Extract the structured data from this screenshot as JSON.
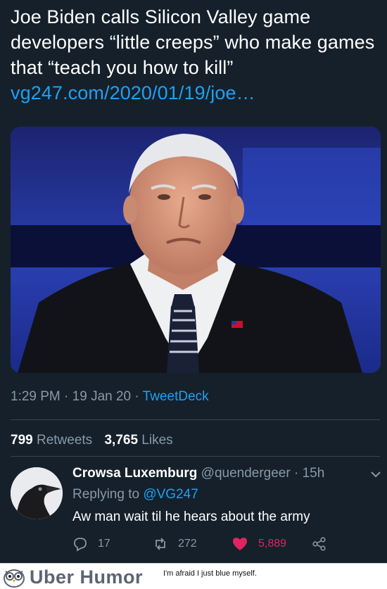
{
  "tweet": {
    "text": "Joe Biden calls Silicon Valley game developers “little creeps” who make games that “teach you how to kill”",
    "link": "vg247.com/2020/01/19/joe…",
    "time": "1:29 PM",
    "date": "19 Jan 20",
    "app": "TweetDeck",
    "retweets_count": "799",
    "retweets_label": "Retweets",
    "likes_count": "3,765",
    "likes_label": "Likes"
  },
  "reply": {
    "name": "Crowsa Luxemburg",
    "handle": "@quendergeer",
    "age": "15h",
    "replying_prefix": "Replying to",
    "replying_handle": "@VG247",
    "text": "Aw man wait til he hears about the army",
    "replies": "17",
    "retweets": "272",
    "likes": "5,889"
  },
  "footer": {
    "brand": "Uber Humor",
    "caption": "I'm afraid I just blue myself."
  },
  "colors": {
    "background": "#15202b",
    "link": "#1da1f2",
    "muted": "#8899a6",
    "like": "#e0245e"
  },
  "icons": [
    "reply-icon",
    "retweet-icon",
    "heart-icon",
    "share-icon",
    "chevron-down-icon",
    "owl-icon"
  ]
}
